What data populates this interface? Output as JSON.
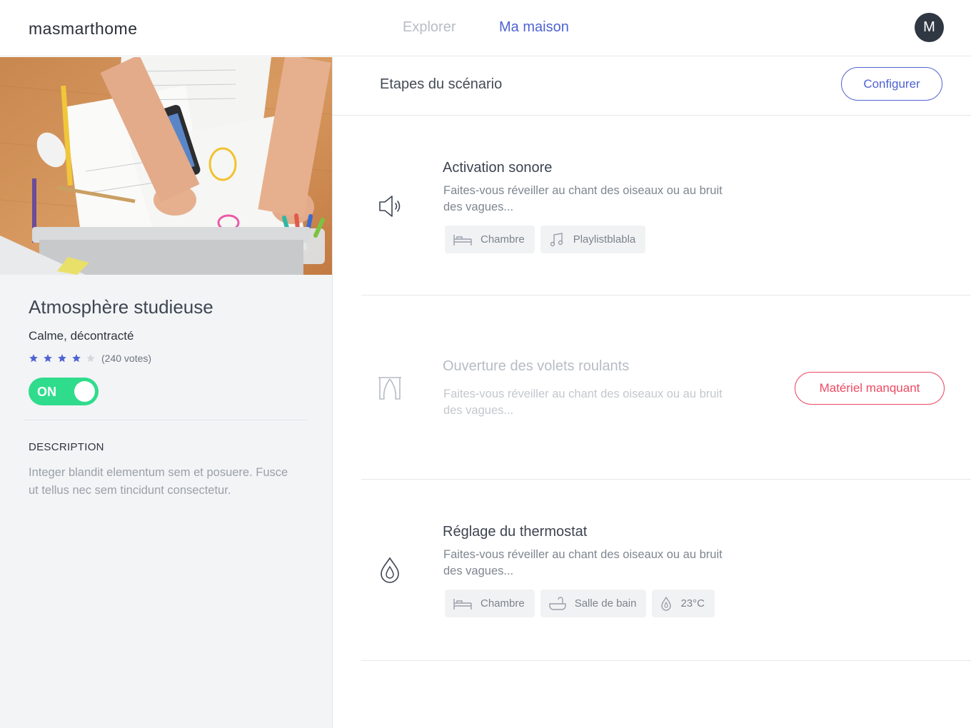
{
  "header": {
    "logo": "masmarthome",
    "nav": {
      "explorer": "Explorer",
      "ma_maison": "Ma maison"
    },
    "avatar_initial": "M"
  },
  "colors": {
    "accent": "#4f63d2",
    "toggle_on": "#2fdc8c",
    "alert": "#ee4a62",
    "star_filled": "#4f63d2",
    "star_empty": "#d4d7dc"
  },
  "scenario": {
    "title": "Atmosphère studieuse",
    "subtitle": "Calme, décontracté",
    "rating": 4,
    "rating_max": 5,
    "votes": "(240 votes)",
    "toggle_label": "ON",
    "toggle_on": true,
    "description_label": "DESCRIPTION",
    "description": "Integer blandit elementum sem et posuere. Fusce ut tellus nec sem tincidunt consectetur."
  },
  "main": {
    "title": "Etapes du scénario",
    "configure_label": "Configurer",
    "steps": [
      {
        "icon": "speaker-icon",
        "title": "Activation sonore",
        "description": "Faites-vous réveiller au chant des oiseaux ou au bruit des vagues...",
        "chips": [
          {
            "icon": "bed-icon",
            "label": "Chambre"
          },
          {
            "icon": "music-note-icon",
            "label": "Playlistblabla"
          }
        ]
      },
      {
        "icon": "curtains-icon",
        "title": "Ouverture des volets roulants",
        "description": "Faites-vous réveiller au chant des oiseaux ou au bruit des vagues...",
        "disabled": true,
        "action_label": "Matériel manquant"
      },
      {
        "icon": "water-drop-icon",
        "title": "Réglage du thermostat",
        "description": "Faites-vous réveiller au chant des oiseaux ou au bruit des vagues...",
        "chips": [
          {
            "icon": "bed-icon",
            "label": "Chambre"
          },
          {
            "icon": "bathtub-icon",
            "label": "Salle de bain"
          },
          {
            "icon": "drop-icon",
            "label": "23°C"
          }
        ]
      }
    ]
  }
}
